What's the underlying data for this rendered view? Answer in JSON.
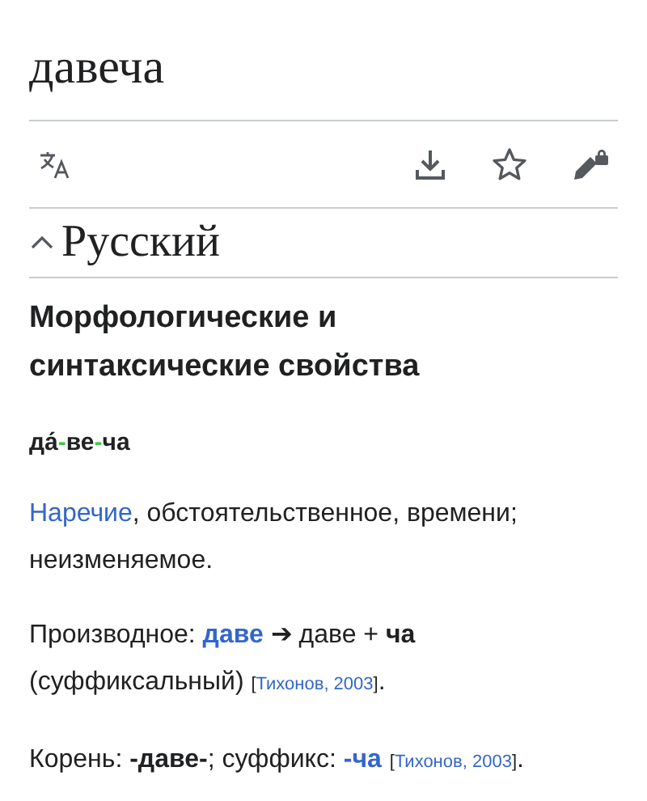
{
  "page_title": "давеча",
  "toolbar": {
    "actions": [
      {
        "kind": "translate"
      },
      {
        "kind": "download"
      },
      {
        "kind": "star"
      },
      {
        "kind": "edit-locked"
      }
    ]
  },
  "section": {
    "title": "Русский",
    "expanded": true,
    "heading": "Морфологические и синтаксические свойства",
    "hyphenation": {
      "syllables": [
        "да́",
        "ве",
        "ча"
      ],
      "separator": "-"
    },
    "paragraphs": [
      [
        {
          "kind": "link",
          "text": "Наречие"
        },
        {
          "kind": "text",
          "text": ", обстоятельственное, времени; неизменяемое."
        }
      ],
      [
        {
          "kind": "text",
          "text": "Производное: "
        },
        {
          "kind": "link",
          "text": "**даве**"
        },
        {
          "kind": "text",
          "text": " ➔ даве + **ча** (суффиксальный) "
        },
        {
          "kind": "ref",
          "open": "[",
          "text": "Тихонов, 2003",
          "close": "]"
        },
        {
          "kind": "text",
          "text": "."
        }
      ],
      [
        {
          "kind": "text",
          "text": "Корень: **-даве-**; суффикс: "
        },
        {
          "kind": "link",
          "text": "**-ча**"
        },
        {
          "kind": "ref",
          "open": "[",
          "text": "Тихонов, 2003",
          "close": "]",
          "spaced": true
        },
        {
          "kind": "text",
          "text": "."
        }
      ]
    ]
  }
}
